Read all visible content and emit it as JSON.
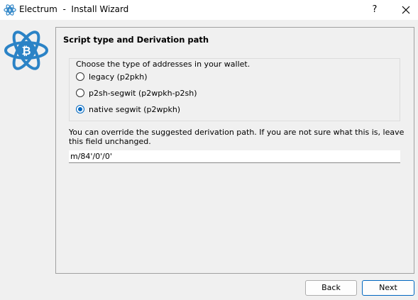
{
  "window": {
    "title": "Electrum  -  Install Wizard",
    "help_label": "?"
  },
  "icons": {
    "app": "electrum-icon",
    "logo": "electrum-logo",
    "close": "close-icon"
  },
  "colors": {
    "accent": "#0067c0",
    "logo_blue": "#2b83c6"
  },
  "panel": {
    "title": "Script type and Derivation path",
    "group_title": "Choose the type of addresses in your wallet.",
    "options": [
      {
        "label": "legacy (p2pkh)",
        "checked": false
      },
      {
        "label": "p2sh-segwit (p2wpkh-p2sh)",
        "checked": false
      },
      {
        "label": "native segwit (p2wpkh)",
        "checked": true
      }
    ],
    "info_text": "You can override the suggested derivation path. If you are not sure what this is, leave this field unchanged.",
    "derivation_path": "m/84'/0'/0'"
  },
  "buttons": {
    "back": "Back",
    "next": "Next"
  }
}
